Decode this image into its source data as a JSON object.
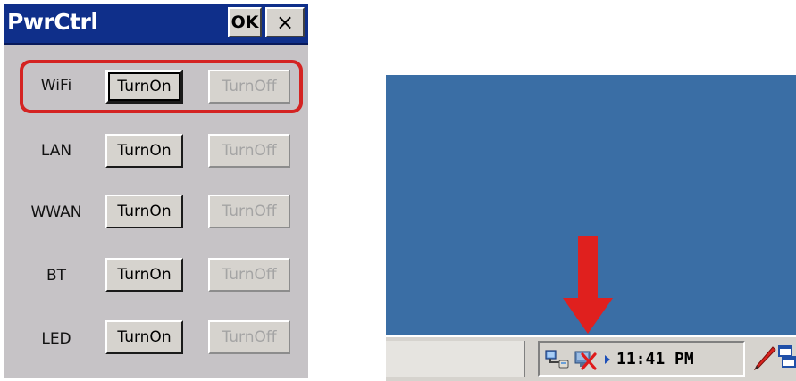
{
  "dialog": {
    "title": "PwrCtrl",
    "ok_label": "OK",
    "close_label": "×",
    "rows": [
      {
        "label": "WiFi",
        "on_label": "TurnOn",
        "off_label": "TurnOff"
      },
      {
        "label": "LAN",
        "on_label": "TurnOn",
        "off_label": "TurnOff"
      },
      {
        "label": "WWAN",
        "on_label": "TurnOn",
        "off_label": "TurnOff"
      },
      {
        "label": "BT",
        "on_label": "TurnOn",
        "off_label": "TurnOff"
      },
      {
        "label": "LED",
        "on_label": "TurnOn",
        "off_label": "TurnOff"
      }
    ]
  },
  "taskbar": {
    "clock": "11:41 PM",
    "tray_icons": [
      "network-icon",
      "wifi-disabled-icon",
      "expand-arrow-icon",
      "pen-icon",
      "desktop-switch-icon"
    ]
  },
  "colors": {
    "title_bar": "#0f2f8a",
    "highlight": "#d42322",
    "desktop": "#3a6ea5",
    "annotation_arrow": "#e0201e"
  }
}
